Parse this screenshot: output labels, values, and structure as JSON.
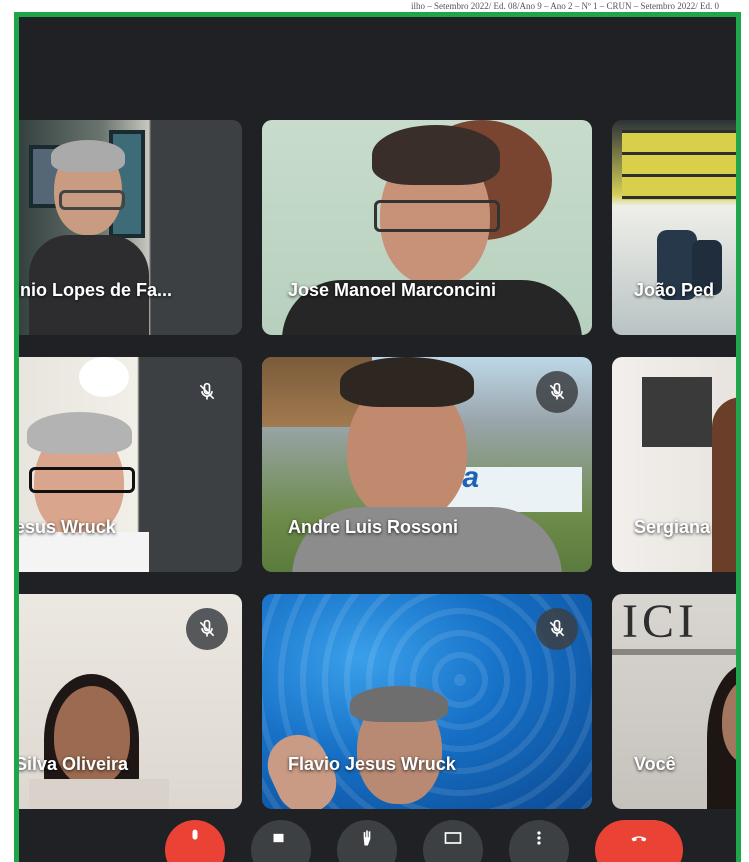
{
  "caption": "ilho – Setembro 2022/ Ed. 08/Ano 9 – Ano 2 – Nº 1 – CRUN – Setembro 2022/ Ed. 0",
  "participants": [
    {
      "name": "inio Lopes de Fa...",
      "muted": false
    },
    {
      "name": "Jose Manoel Marconcini",
      "muted": false
    },
    {
      "name": "João Ped",
      "muted": false
    },
    {
      "name": "esus Wruck",
      "muted": true
    },
    {
      "name": "Andre Luis Rossoni",
      "muted": true
    },
    {
      "name": "Sergiana",
      "muted": false
    },
    {
      "name": "Silva Oliveira",
      "muted": true
    },
    {
      "name": "Flavio Jesus Wruck",
      "muted": true
    },
    {
      "name": "Você",
      "muted": false
    }
  ],
  "tile_texts": {
    "embrapa_sign": "pa",
    "wall_sign": "ICI"
  },
  "icons": {
    "mute": "mic-off-icon",
    "controls": [
      "mic-off-icon",
      "camera-icon",
      "hand-icon",
      "present-icon",
      "more-icon",
      "end-call-icon"
    ]
  },
  "colors": {
    "frame_border": "#1fa64a",
    "background": "#202124",
    "tile_bg": "#3c4043",
    "danger": "#ea4335"
  }
}
